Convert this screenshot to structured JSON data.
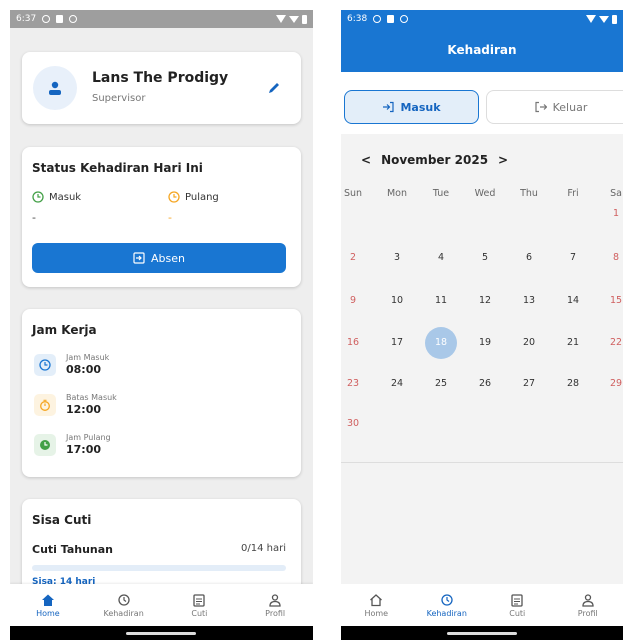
{
  "left_screen": {
    "status_time": "6:37",
    "profile": {
      "name": "Lans The Prodigy",
      "role": "Supervisor"
    },
    "attendance": {
      "title": "Status Kehadiran Hari Ini",
      "in_label": "Masuk",
      "out_label": "Pulang",
      "in_value": "-",
      "out_value": "-",
      "button_label": "Absen"
    },
    "work_hours": {
      "title": "Jam Kerja",
      "items": [
        {
          "label": "Jam Masuk",
          "value": "08:00",
          "icon": "clock-icon",
          "color": "#1976d2",
          "bg": "#e3eef9"
        },
        {
          "label": "Batas Masuk",
          "value": "12:00",
          "icon": "timer-icon",
          "color": "#f5a623",
          "bg": "#fdf3e0"
        },
        {
          "label": "Jam Pulang",
          "value": "17:00",
          "icon": "clock-filled-icon",
          "color": "#43a047",
          "bg": "#e6f3e7"
        }
      ]
    },
    "leave": {
      "title": "Sisa Cuti",
      "type": "Cuti Tahunan",
      "value": "0/14 hari",
      "remaining": "Sisa: 14 hari",
      "used_fraction": 0
    },
    "nav": [
      {
        "label": "Home",
        "icon": "home-icon",
        "active": true
      },
      {
        "label": "Kehadiran",
        "icon": "history-icon",
        "active": false
      },
      {
        "label": "Cuti",
        "icon": "calendar-note-icon",
        "active": false
      },
      {
        "label": "Profil",
        "icon": "person-icon",
        "active": false
      }
    ]
  },
  "right_screen": {
    "status_time": "6:38",
    "title": "Kehadiran",
    "tabs": {
      "masuk": "Masuk",
      "keluar": "Keluar"
    },
    "calendar": {
      "month": "November 2025",
      "prev": "<",
      "next": ">",
      "weekdays": [
        "Sun",
        "Mon",
        "Tue",
        "Wed",
        "Thu",
        "Fri",
        "Sa"
      ],
      "weeks": [
        [
          "",
          "",
          "",
          "",
          "",
          "",
          "1"
        ],
        [
          "2",
          "3",
          "4",
          "5",
          "6",
          "7",
          "8"
        ],
        [
          "9",
          "10",
          "11",
          "12",
          "13",
          "14",
          "15"
        ],
        [
          "16",
          "17",
          "18",
          "19",
          "20",
          "21",
          "22"
        ],
        [
          "23",
          "24",
          "25",
          "26",
          "27",
          "28",
          "29"
        ],
        [
          "30",
          "",
          "",
          "",
          "",
          "",
          ""
        ]
      ],
      "selected": "18"
    },
    "nav": [
      {
        "label": "Home",
        "icon": "home-outline-icon",
        "active": false
      },
      {
        "label": "Kehadiran",
        "icon": "history-icon",
        "active": true
      },
      {
        "label": "Cuti",
        "icon": "calendar-note-icon",
        "active": false
      },
      {
        "label": "Profil",
        "icon": "person-icon",
        "active": false
      }
    ]
  }
}
